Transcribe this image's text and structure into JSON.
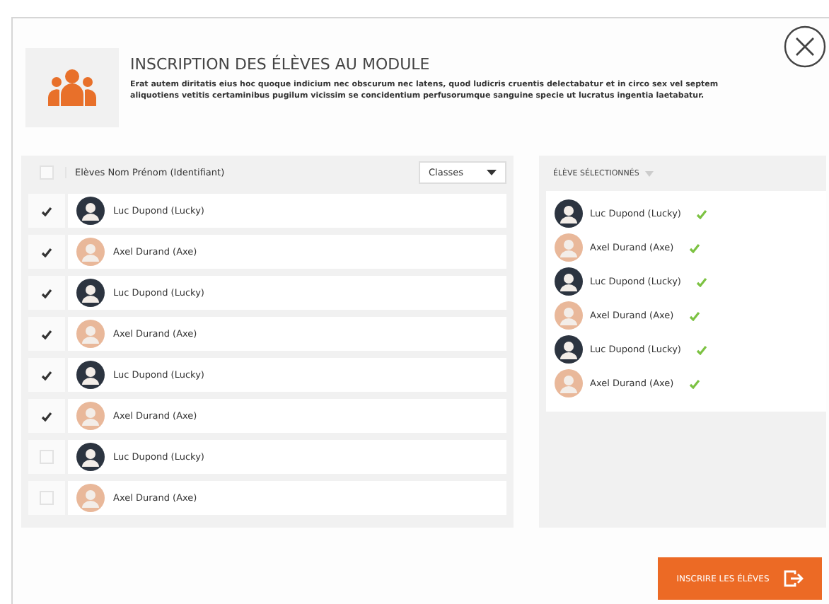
{
  "dialog": {
    "title": "INSCRIPTION DES ÉLÈVES AU MODULE",
    "description": "Erat autem diritatis eius hoc quoque indicium nec obscurum nec latens, quod ludicris cruentis delectabatur et in circo sex vel septem aliquotiens vetitis certaminibus pugilum vicissim se concidentium perfusorumque sanguine specie ut lucratus ingentia laetabatur."
  },
  "students": {
    "select_all_checked": false,
    "column_header": "Elèves Nom Prénom (Identifiant)",
    "filter": {
      "value": "Classes"
    },
    "rows": [
      {
        "name": "Luc Dupond (Lucky)",
        "checked": true
      },
      {
        "name": "Axel Durand (Axe)",
        "checked": true
      },
      {
        "name": "Luc Dupond (Lucky)",
        "checked": true
      },
      {
        "name": "Axel Durand (Axe)",
        "checked": true
      },
      {
        "name": "Luc Dupond (Lucky)",
        "checked": true
      },
      {
        "name": "Axel Durand (Axe)",
        "checked": true
      },
      {
        "name": "Luc Dupond (Lucky)",
        "checked": false
      },
      {
        "name": "Axel Durand (Axe)",
        "checked": false
      }
    ]
  },
  "selected": {
    "header": "ÉLÈVE SÉLECTIONNÉS",
    "items": [
      {
        "name": "Luc Dupond (Lucky)"
      },
      {
        "name": "Axel Durand (Axe)"
      },
      {
        "name": "Luc Dupond (Lucky)"
      },
      {
        "name": "Axel Durand (Axe)"
      },
      {
        "name": "Luc Dupond (Lucky)"
      },
      {
        "name": "Axel Durand (Axe)"
      }
    ]
  },
  "submit_button": "INSCRIRE LES ÉLÈVES"
}
